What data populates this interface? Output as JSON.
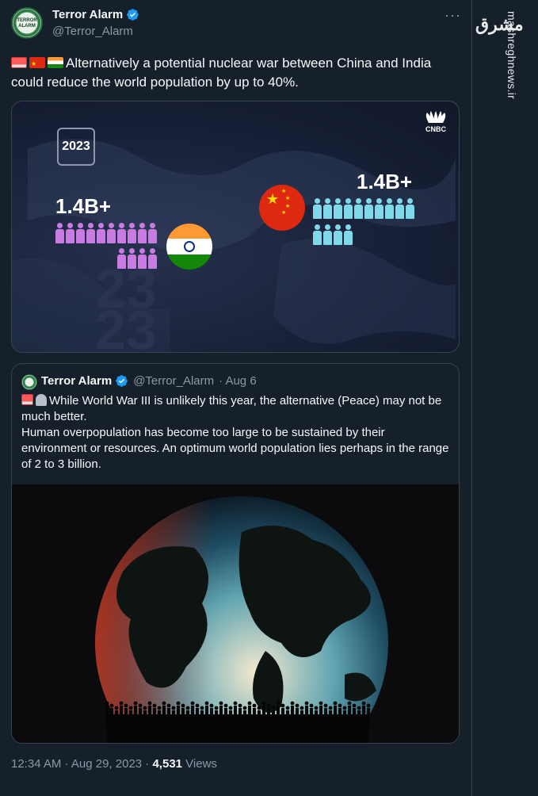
{
  "tweet": {
    "author_name": "Terror Alarm",
    "author_handle": "@Terror_Alarm",
    "avatar_text": "TERROR ALARM",
    "more_label": "···",
    "text": "Alternatively a potential nuclear war between China and India could reduce the world population by up to 40%.",
    "emojis": [
      "siren-icon",
      "china-flag-icon",
      "india-flag-icon"
    ],
    "media": {
      "year": "2023",
      "india_population": "1.4B+",
      "china_population": "1.4B+",
      "brand": "CNBC",
      "background_numbers": [
        "23",
        "23"
      ],
      "colors": {
        "india_people": "#c87be0",
        "china_people": "#7fd9e8"
      }
    },
    "timestamp": "12:34 AM · Aug 29, 2023 · ",
    "views_count": "4,531",
    "views_label": " Views"
  },
  "quote": {
    "author_name": "Terror Alarm",
    "author_handle": "@Terror_Alarm",
    "date": "· Aug 6",
    "line1": "While World War III is unlikely this year, the alternative (Peace) may not be much better.",
    "line2": "Human overpopulation has become too large to be sustained by their environment or resources. An optimum world population lies perhaps in the range of 2 to 3 billion.",
    "emojis": [
      "siren-icon",
      "tombstone-icon"
    ]
  },
  "watermark": {
    "logo": "مشرق",
    "site": "mashreghnews.ir"
  },
  "colors": {
    "background": "#15202b",
    "verified": "#1d9bf0",
    "secondary_text": "#8b98a5"
  }
}
